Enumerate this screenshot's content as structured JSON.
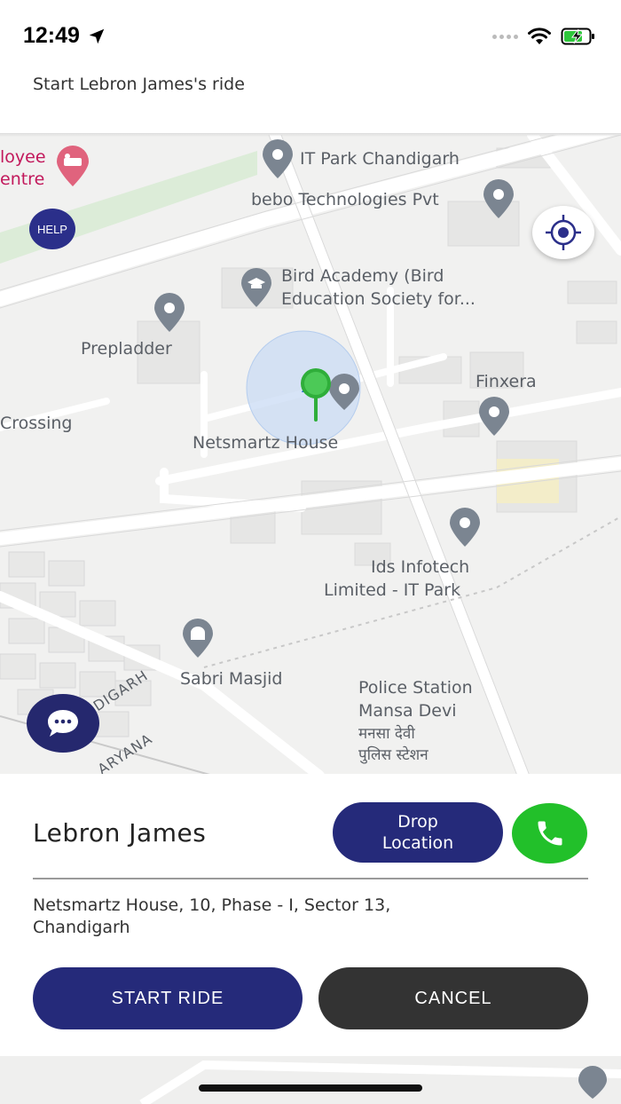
{
  "status_bar": {
    "time": "12:49"
  },
  "header": {
    "title": "Start Lebron James's ride"
  },
  "map": {
    "labels": {
      "employee_centre_line1": "loyee",
      "employee_centre_line2": "entre",
      "it_park": "IT Park Chandigarh",
      "bebo": "bebo Technologies Pvt",
      "bird_line1": "Bird Academy (Bird",
      "bird_line2": "Education Society for...",
      "prepladder": "Prepladder",
      "finxera": "Finxera",
      "crossing": "Crossing",
      "netsmartz": "Netsmartz House",
      "ids_line1": "Ids Infotech",
      "ids_line2": "Limited - IT Park",
      "sabri": "Sabri Masjid",
      "police_line1": "Police Station",
      "police_line2": "Mansa Devi",
      "police_hi_line1": "मनसा देवी",
      "police_hi_line2": "पुलिस स्टेशन",
      "chandigarh": "CHANDIGARH",
      "haryana": "ARYANA"
    },
    "help_label": "HELP",
    "colors": {
      "background": "#f1f1f0",
      "pin": "#7b8591",
      "current_pin": "#2fae3a",
      "accuracy_circle": "#c9dbf4"
    }
  },
  "card": {
    "rider_name": "Lebron James",
    "drop_location_label": "Drop\nLocation",
    "address": "Netsmartz House, 10, Phase - I, Sector 13, Chandigarh",
    "start_ride_label": "START RIDE",
    "cancel_label": "CANCEL"
  },
  "icons": {
    "location_arrow": "location-arrow-icon",
    "wifi": "wifi-icon",
    "battery": "battery-charging-icon",
    "locate": "my-location-icon",
    "chat": "chat-bubble-icon",
    "phone": "phone-icon"
  },
  "theme": {
    "primary": "#252a7a",
    "call_green": "#22c02a",
    "cancel_dark": "#333333"
  }
}
